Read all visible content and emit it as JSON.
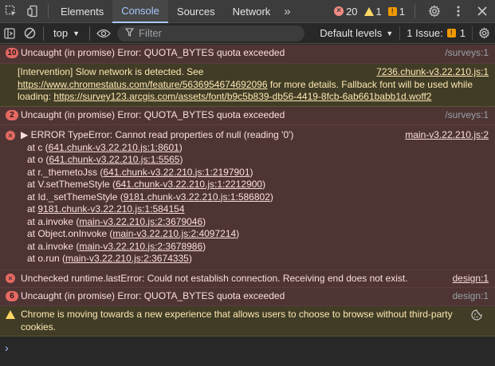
{
  "tabbar": {
    "tabs": [
      "Elements",
      "Console",
      "Sources",
      "Network"
    ],
    "more": "»",
    "error_count": "20",
    "warning_count": "1",
    "issue_count": "1"
  },
  "toolbar": {
    "context": "top",
    "filter_placeholder": "Filter",
    "levels": "Default levels",
    "issues_label": "1 Issue:",
    "issues_count": "1"
  },
  "messages": {
    "m1": {
      "count": "10",
      "text": "Uncaught (in promise) Error: QUOTA_BYTES quota exceeded",
      "source": "/surveys:1"
    },
    "m2": {
      "text_a": "[Intervention] Slow network is detected. See",
      "link1": "https://www.chromestatus.com/feature/5636954674692096",
      "text_b": "for more details. Fallback font will be used while loading:",
      "link2": "https://survey123.arcgis.com/assets/font/b9c5b839-db56-4419-8fcb-6ab661babb1d.woff2",
      "source": "7236.chunk-v3.22.210.js:1"
    },
    "m3": {
      "count": "2",
      "text": "Uncaught (in promise) Error: QUOTA_BYTES quota exceeded",
      "source": "/surveys:1"
    },
    "m4": {
      "head": "▶ ERROR TypeError: Cannot read properties of null (reading '0')",
      "source": "main-v3.22.210.js:2",
      "frames": [
        {
          "pre": "at c (",
          "link": "641.chunk-v3.22.210.js:1:8601",
          "post": ")"
        },
        {
          "pre": "at o (",
          "link": "641.chunk-v3.22.210.js:1:5565",
          "post": ")"
        },
        {
          "pre": "at r._themetoJss (",
          "link": "641.chunk-v3.22.210.js:1:2197901",
          "post": ")"
        },
        {
          "pre": "at V.setThemeStyle (",
          "link": "641.chunk-v3.22.210.js:1:2212900",
          "post": ")"
        },
        {
          "pre": "at Id._setThemeStyle (",
          "link": "9181.chunk-v3.22.210.js:1:586802",
          "post": ")"
        },
        {
          "pre": "at ",
          "link": "9181.chunk-v3.22.210.js:1:584154",
          "post": ""
        },
        {
          "pre": "at a.invoke (",
          "link": "main-v3.22.210.js:2:3679046",
          "post": ")"
        },
        {
          "pre": "at Object.onInvoke (",
          "link": "main-v3.22.210.js:2:4097214",
          "post": ")"
        },
        {
          "pre": "at a.invoke (",
          "link": "main-v3.22.210.js:2:3678986",
          "post": ")"
        },
        {
          "pre": "at o.run (",
          "link": "main-v3.22.210.js:2:3674335",
          "post": ")"
        }
      ]
    },
    "m5": {
      "text": "Unchecked runtime.lastError: Could not establish connection. Receiving end does not exist.",
      "source": "design:1"
    },
    "m6": {
      "count": "6",
      "text": "Uncaught (in promise) Error: QUOTA_BYTES quota exceeded",
      "source": "design:1"
    },
    "m7": {
      "text": "Chrome is moving towards a new experience that allows users to choose to browse without third-party cookies."
    }
  },
  "prompt": "›",
  "icons": {
    "inspect": "inspect-element-icon",
    "device": "device-toolbar-icon",
    "settings": "gear-icon",
    "more": "more-vert-icon",
    "close": "close-icon",
    "sidebar": "sidebar-toggle-icon",
    "clear": "clear-console-icon",
    "eye": "live-expression-icon",
    "filter": "filter-icon",
    "cookie": "cookie-icon"
  }
}
